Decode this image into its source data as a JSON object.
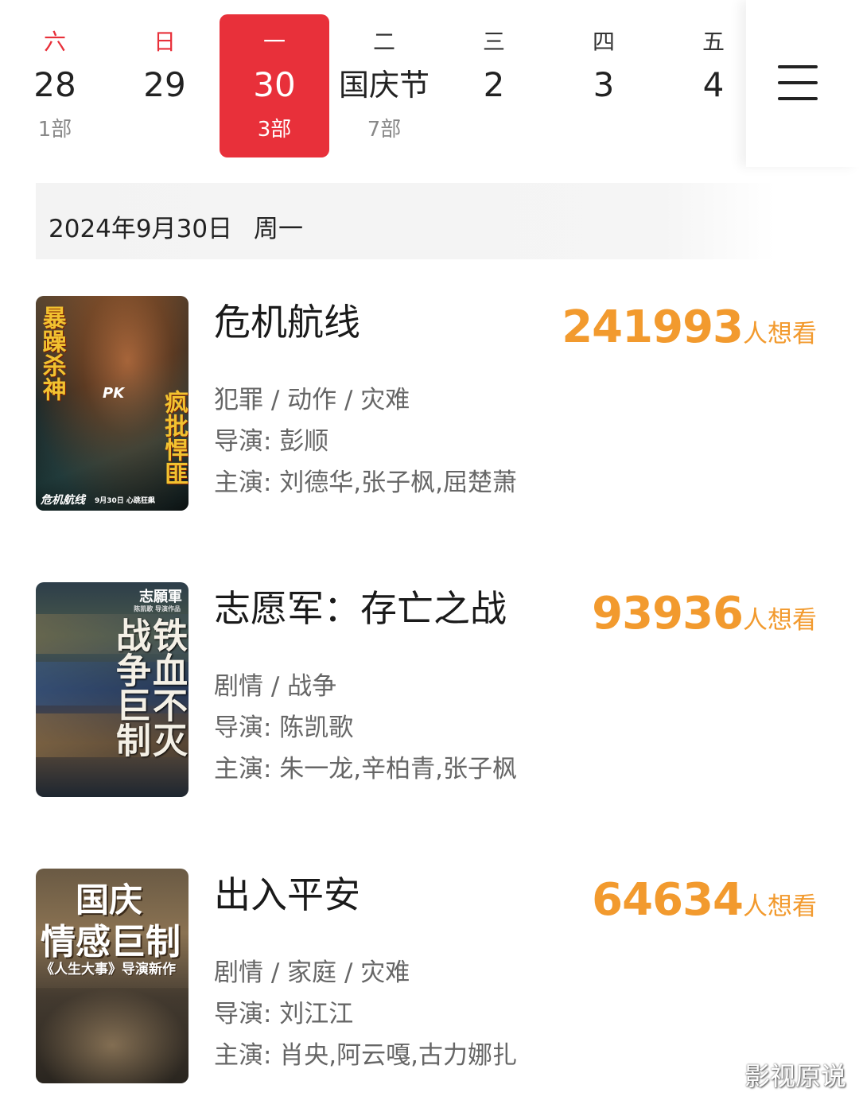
{
  "date_strip": {
    "days": [
      {
        "weekday": "六",
        "date": "28",
        "count": "1部"
      },
      {
        "weekday": "日",
        "date": "29",
        "count": "",
        "note": ""
      },
      {
        "weekday": "一",
        "date": "30",
        "count": "3部"
      },
      {
        "weekday": "二",
        "date": "国庆节",
        "count": "7部"
      },
      {
        "weekday": "三",
        "date": "2",
        "count": ""
      },
      {
        "weekday": "四",
        "date": "3",
        "count": ""
      },
      {
        "weekday": "五",
        "date": "4",
        "count": ""
      }
    ],
    "selected_index": 2,
    "weekend_color": "#e8303a",
    "selected_bg": "#e8303a",
    "menu_icon": "menu-icon"
  },
  "date_header": {
    "date": "2024年9月30日",
    "weekday": "周一"
  },
  "movies": [
    {
      "title": "危机航线",
      "want_count": "241993",
      "want_label": "人想看",
      "genre": "犯罪 / 动作 / 灾难",
      "director": "导演: 彭顺",
      "cast": "主演: 刘德华,张子枫,屈楚萧",
      "poster": {
        "left_text": "暴躁杀神",
        "right_text": "疯批悍匪",
        "center_text": "PK",
        "title_text": "危机航线",
        "sub_text": "9月30日 心跳狂飙"
      }
    },
    {
      "title": "志愿军：存亡之战",
      "want_count": "93936",
      "want_label": "人想看",
      "genre": "剧情 / 战争",
      "director": "导演: 陈凯歌",
      "cast": "主演: 朱一龙,辛柏青,张子枫",
      "poster": {
        "brand": "志願軍",
        "credit": "陈凯歌 导演作品",
        "col1": "铁血不灭",
        "col2": "战争巨制"
      }
    },
    {
      "title": "出入平安",
      "want_count": "64634",
      "want_label": "人想看",
      "genre": "剧情 / 家庭 / 灾难",
      "director": "导演: 刘江江",
      "cast": "主演: 肖央,阿云嘎,古力娜扎",
      "poster": {
        "line1": "国庆",
        "line2": "情感巨制",
        "line3": "《人生大事》导演新作"
      }
    }
  ],
  "accent_color": "#f29a2e",
  "watermark": "影视原说"
}
